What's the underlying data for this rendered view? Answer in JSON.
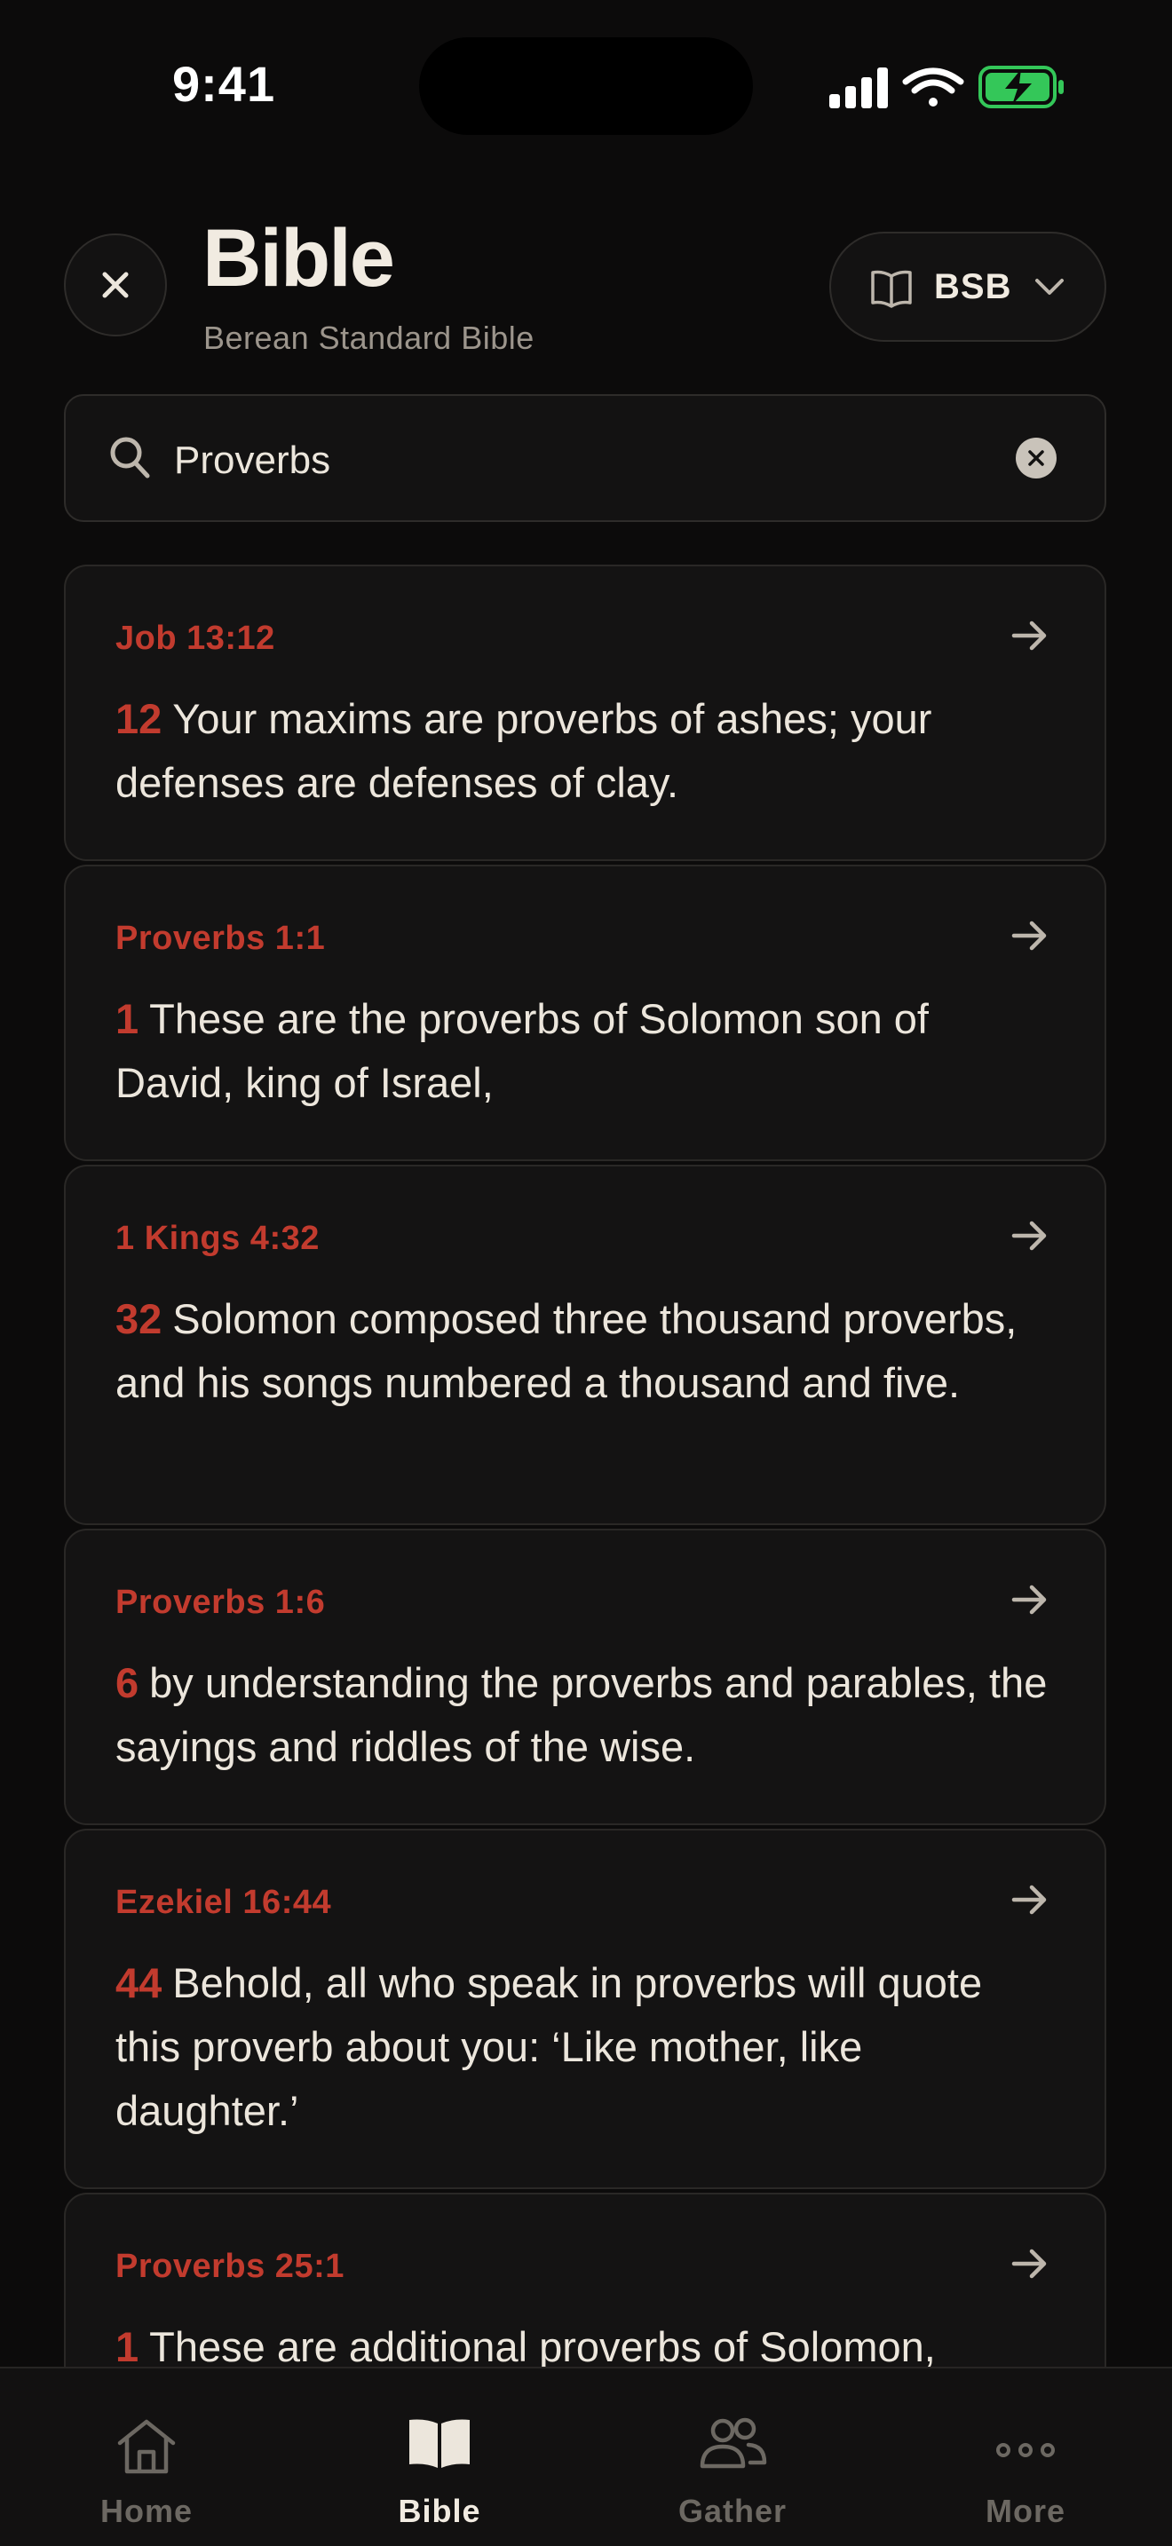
{
  "status_bar": {
    "time": "9:41"
  },
  "header": {
    "close_icon": "close-icon",
    "title": "Bible",
    "subtitle": "Berean Standard Bible",
    "version_label": "BSB"
  },
  "search": {
    "value": "Proverbs"
  },
  "results": [
    {
      "ref": "Job 13:12",
      "verse": "12",
      "text": "Your maxims are proverbs of ashes; your defenses are defenses of clay."
    },
    {
      "ref": "Proverbs 1:1",
      "verse": "1",
      "text": "These are the proverbs of Solomon son of David, king of Israel,"
    },
    {
      "ref": "1 Kings 4:32",
      "verse": "32",
      "text": "Solomon composed three thousand proverbs, and his songs numbered a thousand and five."
    },
    {
      "ref": "Proverbs 1:6",
      "verse": "6",
      "text": "by understanding the proverbs and parables, the sayings and riddles of the wise."
    },
    {
      "ref": "Ezekiel 16:44",
      "verse": "44",
      "text": "Behold, all who speak in proverbs will quote this proverb about you: ‘Like mother, like daughter.’"
    },
    {
      "ref": "Proverbs 25:1",
      "verse": "1",
      "text": "These are additional proverbs of Solomon,"
    }
  ],
  "tabbar": {
    "tabs": [
      {
        "label": "Home",
        "icon": "home-icon"
      },
      {
        "label": "Bible",
        "icon": "book-icon"
      },
      {
        "label": "Gather",
        "icon": "people-icon"
      },
      {
        "label": "More",
        "icon": "more-icon"
      }
    ]
  },
  "colors": {
    "accent": "#c23b2e",
    "background": "#0c0b0b",
    "card": "#141313",
    "battery": "#34c759"
  }
}
